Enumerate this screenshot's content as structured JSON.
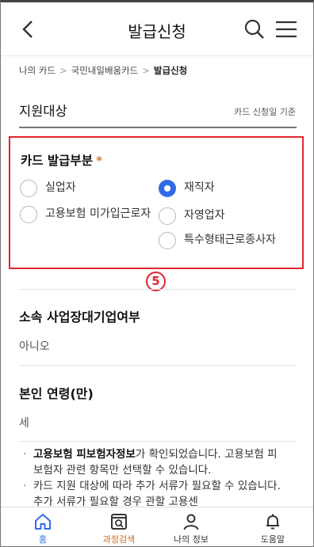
{
  "header": {
    "title": "발급신청"
  },
  "breadcrumb": {
    "items": [
      "나의 카드",
      "국민내일배움카드"
    ],
    "current": "발급신청"
  },
  "target_section": {
    "title": "지원대상",
    "note": "카드 신청일 기준"
  },
  "card_type": {
    "title": "카드 발급부분",
    "required_mark": "*",
    "options": [
      {
        "label": "실업자",
        "checked": false
      },
      {
        "label": "재직자",
        "checked": true
      },
      {
        "label": "고용보험 미가입근로자",
        "checked": false
      },
      {
        "label": "자영업자",
        "checked": false
      },
      {
        "label": "특수형태근로종사자",
        "checked": false
      }
    ]
  },
  "annotation": "5",
  "affiliation": {
    "label": "소속 사업장대기업여부",
    "value": "아니오"
  },
  "age": {
    "label": "본인 연령(만)",
    "value": "세"
  },
  "notice": {
    "item1_bold": "고용보험 피보험자정보",
    "item1_rest": "가 확인되었습니다. 고용보험 피보험자 관련 항목만 선택할 수 있습니다.",
    "item2": "카드 지원 대상에 따라 추가 서류가 필요할 수 있습니다. 추가 서류가 필요할 경우 관할 고용센"
  },
  "tabbar": {
    "home": "홈",
    "course_search": "과정검색",
    "my_info": "나의 정보",
    "help": "도움말"
  },
  "colors": {
    "accent": "#2f6be6",
    "highlight_box": "#e3262f",
    "active_tab": "#d06a1b",
    "required": "#e07a2b"
  }
}
